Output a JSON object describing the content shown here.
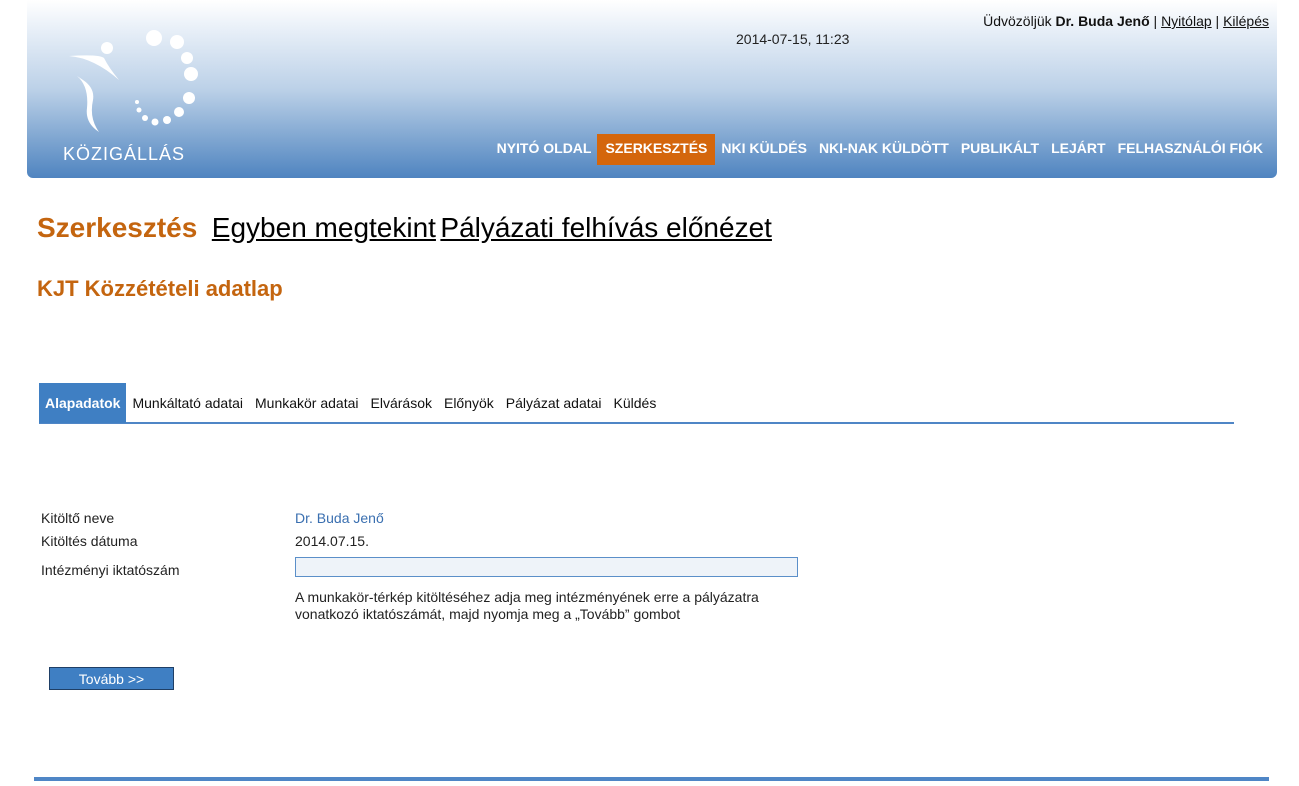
{
  "header": {
    "logo_text": "KÖZIGÁLLÁS",
    "datetime": "2014-07-15, 11:23",
    "greeting": "Üdvözöljük",
    "user_name": "Dr. Buda Jenő",
    "separator": "|",
    "home_link": "Nyitólap",
    "logout_link": "Kilépés",
    "nav": [
      "NYITÓ OLDAL",
      "SZERKESZTÉS",
      "NKI KÜLDÉS",
      "NKI-NAK KÜLDÖTT",
      "PUBLIKÁLT",
      "LEJÁRT",
      "FELHASZNÁLÓI FIÓK"
    ],
    "active_nav": "SZERKESZTÉS"
  },
  "page": {
    "title": "Szerkesztés",
    "link_view_all": "Egyben megtekint",
    "link_preview": "Pályázati felhívás előnézet",
    "subtitle": "KJT Közzétételi adatlap"
  },
  "tabs": [
    "Alapadatok",
    "Munkáltató adatai",
    "Munkakör adatai",
    "Elvárások",
    "Előnyök",
    "Pályázat adatai",
    "Küldés"
  ],
  "active_tab": "Alapadatok",
  "form": {
    "filler_label": "Kitöltő neve",
    "filler_value": "Dr. Buda Jenő",
    "date_label": "Kitöltés dátuma",
    "date_value": "2014.07.15.",
    "ref_label": "Intézményi iktatószám",
    "ref_value": "",
    "help_text": "A munkakör-térkép kitöltéséhez adja meg intézményének erre a pályázatra vonatkozó iktatószámát, majd nyomja meg a „Tovább” gombot",
    "next_button": "Tovább >>"
  },
  "colors": {
    "accent": "#c4650f",
    "active_nav_bg": "#d4660c",
    "primary_blue": "#3f7fc3",
    "link_blue": "#3a6fb0"
  }
}
